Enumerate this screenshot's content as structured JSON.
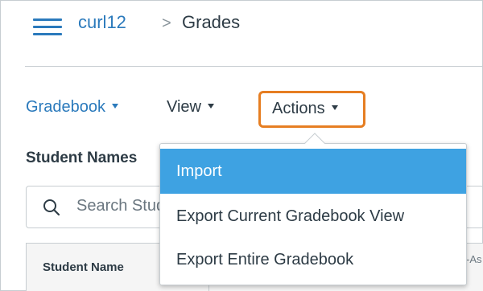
{
  "header": {
    "course": "curl12",
    "separator": ">",
    "page": "Grades"
  },
  "toolbar": {
    "gradebook": "Gradebook",
    "view": "View",
    "actions": "Actions"
  },
  "section": {
    "title": "Student Names"
  },
  "search": {
    "placeholder": "Search Students"
  },
  "table": {
    "columns": [
      "Student Name",
      "-As"
    ]
  },
  "dropdown": {
    "items": [
      "Import",
      "Export Current Gradebook View",
      "Export Entire Gradebook"
    ],
    "highlighted": "Import"
  },
  "colors": {
    "link": "#2b7abc",
    "text": "#2d3b45",
    "highlight": "#3ea2e2",
    "focus_ring": "#e67e22",
    "border": "#c7cdd1"
  },
  "icons": [
    "hamburger-icon",
    "search-icon",
    "caret-down-icon"
  ]
}
